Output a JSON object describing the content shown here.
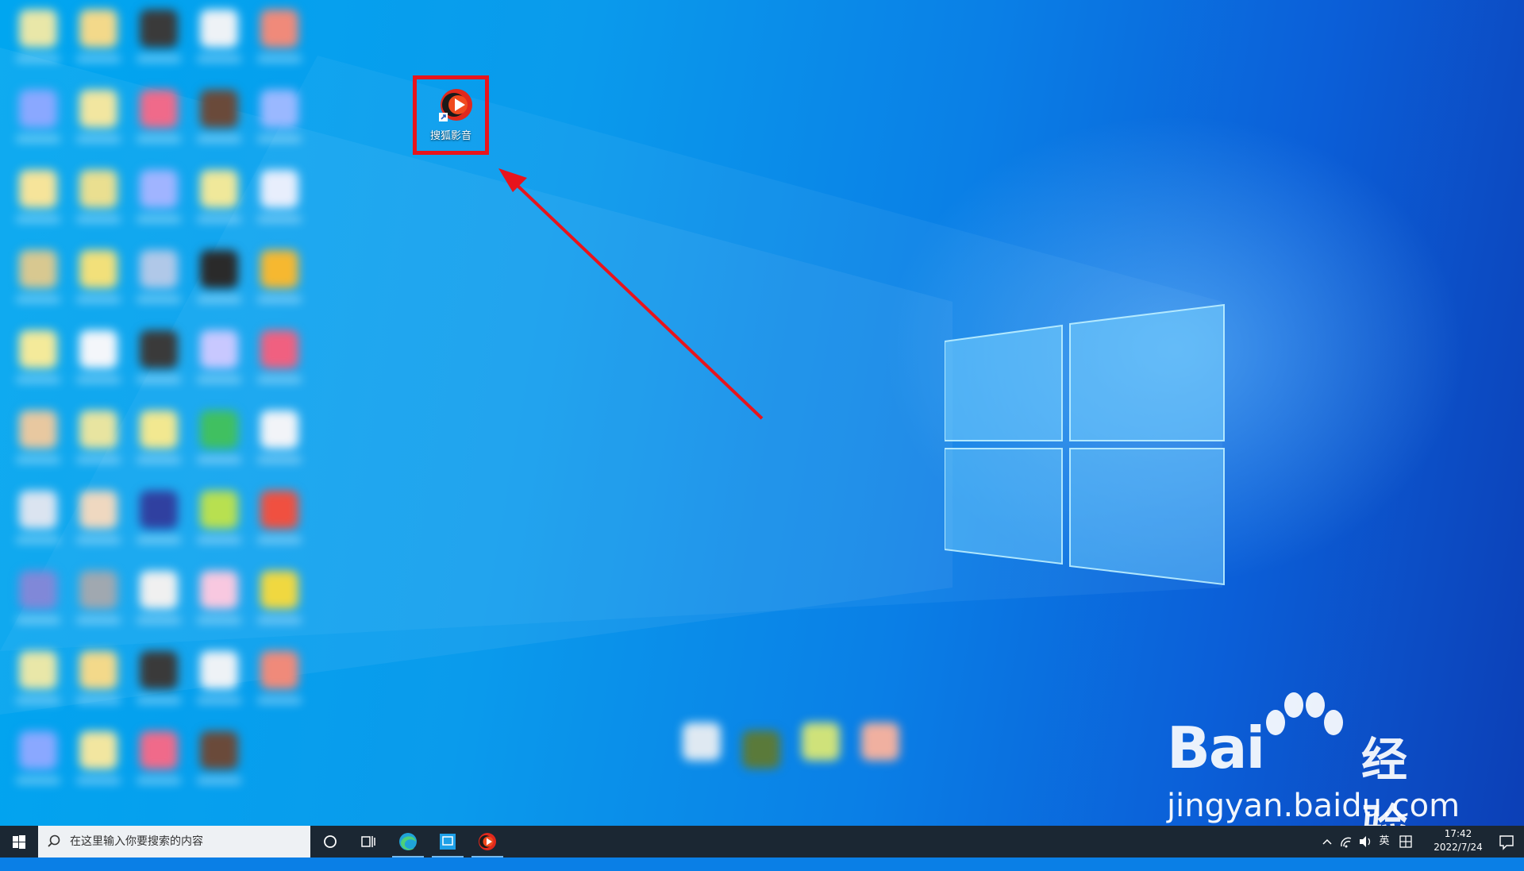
{
  "desktop": {
    "shortcut": {
      "label": "搜狐影音",
      "icon": "sohu-video-icon"
    }
  },
  "watermark": {
    "brand": "Bai",
    "brand_cn": "经验",
    "url": "jingyan.baidu.com"
  },
  "taskbar": {
    "search_placeholder": "在这里输入你要搜索的内容",
    "ime_label": "英",
    "time": "17:42",
    "date": "2022/7/24",
    "apps": [
      "cortana-icon",
      "task-view-icon",
      "edge-icon",
      "store-icon",
      "sohu-video-icon"
    ]
  },
  "colors": {
    "highlight": "#e8141c",
    "taskbar": "#1b2733"
  }
}
